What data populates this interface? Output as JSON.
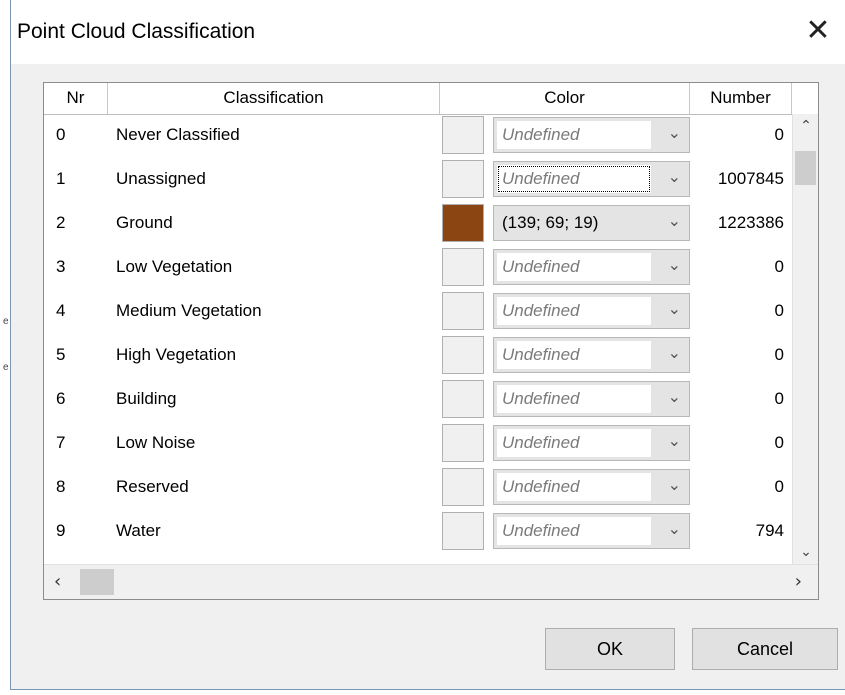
{
  "window": {
    "title": "Point Cloud Classification",
    "close_icon": "close-icon"
  },
  "table": {
    "headers": {
      "nr": "Nr",
      "classification": "Classification",
      "color": "Color",
      "number": "Number"
    },
    "rows": [
      {
        "nr": "0",
        "classification": "Never Classified",
        "color": "Undefined",
        "number": "0",
        "swatch": "#f0f0f0",
        "defined": false
      },
      {
        "nr": "1",
        "classification": "Unassigned",
        "color": "Undefined",
        "number": "1007845",
        "swatch": "#f0f0f0",
        "defined": false,
        "focused": true
      },
      {
        "nr": "2",
        "classification": "Ground",
        "color": "(139;  69;  19)",
        "number": "1223386",
        "swatch": "#8b4513",
        "defined": true
      },
      {
        "nr": "3",
        "classification": "Low Vegetation",
        "color": "Undefined",
        "number": "0",
        "swatch": "#f0f0f0",
        "defined": false
      },
      {
        "nr": "4",
        "classification": "Medium Vegetation",
        "color": "Undefined",
        "number": "0",
        "swatch": "#f0f0f0",
        "defined": false
      },
      {
        "nr": "5",
        "classification": "High Vegetation",
        "color": "Undefined",
        "number": "0",
        "swatch": "#f0f0f0",
        "defined": false
      },
      {
        "nr": "6",
        "classification": "Building",
        "color": "Undefined",
        "number": "0",
        "swatch": "#f0f0f0",
        "defined": false
      },
      {
        "nr": "7",
        "classification": "Low Noise",
        "color": "Undefined",
        "number": "0",
        "swatch": "#f0f0f0",
        "defined": false
      },
      {
        "nr": "8",
        "classification": "Reserved",
        "color": "Undefined",
        "number": "0",
        "swatch": "#f0f0f0",
        "defined": false
      },
      {
        "nr": "9",
        "classification": "Water",
        "color": "Undefined",
        "number": "794",
        "swatch": "#f0f0f0",
        "defined": false
      }
    ]
  },
  "buttons": {
    "ok": "OK",
    "cancel": "Cancel"
  }
}
